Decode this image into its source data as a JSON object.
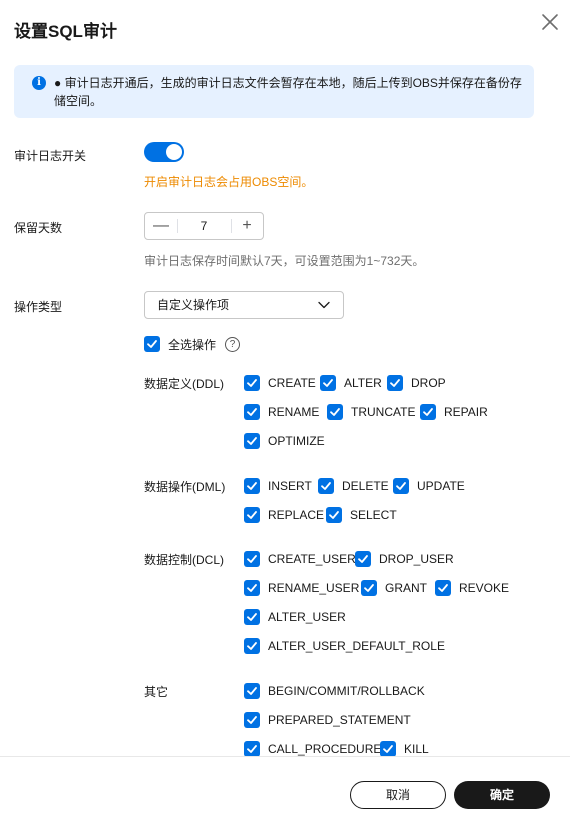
{
  "dialog": {
    "title": "设置SQL审计",
    "close_icon": "close-icon"
  },
  "info": {
    "icon": "info-icon",
    "text": "● 审计日志开通后，生成的审计日志文件会暂存在本地，随后上传到OBS并保存在备份存储空间。"
  },
  "audit_switch": {
    "label": "审计日志开关",
    "enabled": true,
    "warning": "开启审计日志会占用OBS空间。"
  },
  "retention": {
    "label": "保留天数",
    "minus": "—",
    "value": "7",
    "plus": "+",
    "hint": "审计日志保存时间默认7天，可设置范围为1~732天。"
  },
  "operation_type": {
    "label": "操作类型",
    "selected": "自定义操作项",
    "select_all_label": "全选操作",
    "help_icon": "?"
  },
  "groups": {
    "ddl": {
      "label": "数据定义(DDL)",
      "items": [
        "CREATE",
        "ALTER",
        "DROP",
        "RENAME",
        "TRUNCATE",
        "REPAIR",
        "OPTIMIZE"
      ]
    },
    "dml": {
      "label": "数据操作(DML)",
      "items": [
        "INSERT",
        "DELETE",
        "UPDATE",
        "REPLACE",
        "SELECT"
      ]
    },
    "dcl": {
      "label": "数据控制(DCL)",
      "items": [
        "CREATE_USER",
        "DROP_USER",
        "RENAME_USER",
        "GRANT",
        "REVOKE",
        "ALTER_USER",
        "ALTER_USER_DEFAULT_ROLE"
      ]
    },
    "other": {
      "label": "其它",
      "items": [
        "BEGIN/COMMIT/ROLLBACK",
        "PREPARED_STATEMENT",
        "CALL_PROCEDURE",
        "KILL"
      ]
    }
  },
  "footer": {
    "cancel": "取消",
    "ok": "确定"
  },
  "colors": {
    "accent": "#0071e3",
    "warning": "#ed8a00",
    "info_bg": "#e6f1ff",
    "primary_button": "#191919"
  }
}
